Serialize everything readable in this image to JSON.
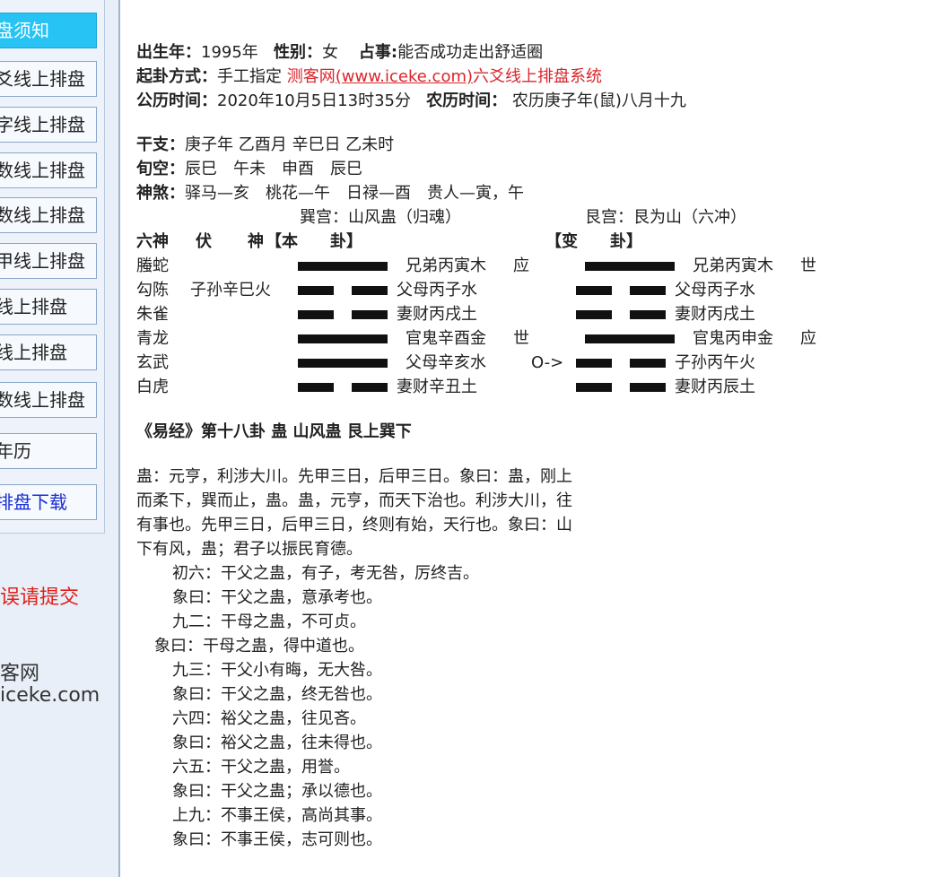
{
  "sidebar": {
    "items": [
      {
        "label": "盘须知",
        "state": "active"
      },
      {
        "label": "爻线上排盘"
      },
      {
        "label": "字线上排盘"
      },
      {
        "label": "数线上排盘"
      },
      {
        "label": "数线上排盘"
      },
      {
        "label": "甲线上排盘"
      },
      {
        "label": "线上排盘"
      },
      {
        "label": "线上排盘"
      },
      {
        "label": "数线上排盘"
      },
      {
        "label": "年历"
      },
      {
        "label": "排盘下载",
        "style": "link"
      }
    ],
    "feedback": "误请提交",
    "brand_name": "客网",
    "brand_url": "iceke.com"
  },
  "header": {
    "birth_year_label": "出生年：",
    "birth_year": "1995年",
    "gender_label": "性别：",
    "gender": "女",
    "question_label": "占事:",
    "question": "能否成功走出舒适圈",
    "method_label": "起卦方式：",
    "method": "手工指定",
    "site_name": "测客网",
    "site_url": "(www.iceke.com)",
    "site_suffix": "六爻线上排盘系统",
    "solar_label": "公历时间：",
    "solar": "2020年10月5日13时35分",
    "lunar_label": "农历时间：",
    "lunar": "农历庚子年(鼠)八月十九"
  },
  "info": {
    "ganzhi_label": "干支：",
    "ganzhi": "庚子年 乙酉月 辛巳日 乙未时",
    "xunkong_label": "旬空：",
    "xunkong": "辰巳　午未　申酉　辰巳",
    "shensha_label": "神煞：",
    "shensha": "驿马—亥　桃花—午　日禄—酉　贵人—寅，午",
    "palace_main": "巽宫：山风蛊（归魂）",
    "palace_changed": "艮宫：艮为山（六冲）"
  },
  "table_header": {
    "liushen": "六神",
    "fu": "伏",
    "shen": "神",
    "main_gua": "【本　　卦】",
    "changed_gua": "【变　　卦】"
  },
  "lines": [
    {
      "liushen": "螣蛇",
      "hidden": "",
      "main_type": "yang",
      "main": "兄弟丙寅木",
      "main_mark": "应",
      "move": "",
      "changed_type": "yang",
      "changed": "兄弟丙寅木",
      "changed_mark": "世"
    },
    {
      "liushen": "勾陈",
      "hidden": "子孙辛巳火",
      "main_type": "yin",
      "main": "父母丙子水",
      "main_mark": "",
      "move": "",
      "changed_type": "yin",
      "changed": "父母丙子水",
      "changed_mark": ""
    },
    {
      "liushen": "朱雀",
      "hidden": "",
      "main_type": "yin",
      "main": "妻财丙戌土",
      "main_mark": "",
      "move": "",
      "changed_type": "yin",
      "changed": "妻财丙戌土",
      "changed_mark": ""
    },
    {
      "liushen": "青龙",
      "hidden": "",
      "main_type": "yang",
      "main": "官鬼辛酉金",
      "main_mark": "世",
      "move": "",
      "changed_type": "yang",
      "changed": "官鬼丙申金",
      "changed_mark": "应"
    },
    {
      "liushen": "玄武",
      "hidden": "",
      "main_type": "yang",
      "main": "父母辛亥水",
      "main_mark": "",
      "move": "O->",
      "changed_type": "yin",
      "changed": "子孙丙午火",
      "changed_mark": ""
    },
    {
      "liushen": "白虎",
      "hidden": "",
      "main_type": "yin",
      "main": "妻财辛丑土",
      "main_mark": "",
      "move": "",
      "changed_type": "yin",
      "changed": "妻财丙辰土",
      "changed_mark": ""
    }
  ],
  "gua_title": "《易经》第十八卦 蛊 山风蛊 艮上巽下",
  "text": {
    "p1": "蛊：元亨，利涉大川。先甲三日，后甲三日。象曰：蛊，刚上",
    "p2": "而柔下，巽而止，蛊。蛊，元亨，而天下治也。利涉大川，往",
    "p3": "有事也。先甲三日，后甲三日，终则有始，天行也。象曰：山",
    "p4": "下有风，蛊；君子以振民育德。",
    "y1": "初六：干父之蛊，有子，考无咎，厉终吉。",
    "y1x": "象曰：干父之蛊，意承考也。",
    "y2": "九二：干母之蛊，不可贞。",
    "y2x": "象曰：干母之蛊，得中道也。",
    "y3": "九三：干父小有晦，无大咎。",
    "y3x": "象曰：干父之蛊，终无咎也。",
    "y4": "六四：裕父之蛊，往见吝。",
    "y4x": "象曰：裕父之蛊，往未得也。",
    "y5": "六五：干父之蛊，用誉。",
    "y5x": "象曰：干父之蛊；承以德也。",
    "y6": "上九：不事王侯，高尚其事。",
    "y6x": "象曰：不事王侯，志可则也。"
  }
}
